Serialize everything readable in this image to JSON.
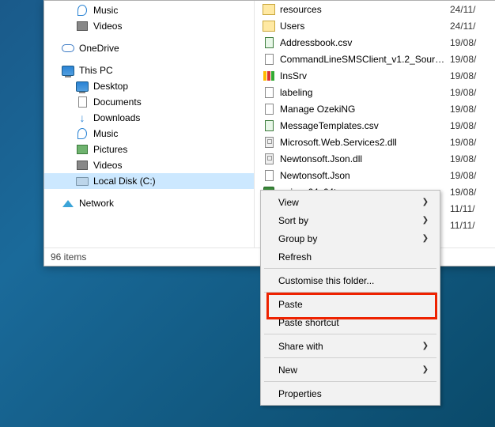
{
  "tree": {
    "music": "Music",
    "videos": "Videos",
    "onedrive": "OneDrive",
    "thispc": "This PC",
    "desktop": "Desktop",
    "documents": "Documents",
    "downloads": "Downloads",
    "music2": "Music",
    "pictures": "Pictures",
    "videos2": "Videos",
    "localdisk": "Local Disk (C:)",
    "network": "Network"
  },
  "files": [
    {
      "icon": "i-fol",
      "name": "resources",
      "date": "24/11/"
    },
    {
      "icon": "i-fol",
      "name": "Users",
      "date": "24/11/"
    },
    {
      "icon": "i-csv",
      "name": "Addressbook.csv",
      "date": "19/08/"
    },
    {
      "icon": "i-app",
      "name": "CommandLineSMSClient_v1.2_Source_D...",
      "date": "19/08/"
    },
    {
      "icon": "i-sig",
      "name": "InsSrv",
      "date": "19/08/"
    },
    {
      "icon": "i-doc",
      "name": "labeling",
      "date": "19/08/"
    },
    {
      "icon": "i-app",
      "name": "Manage OzekiNG",
      "date": "19/08/"
    },
    {
      "icon": "i-csv",
      "name": "MessageTemplates.csv",
      "date": "19/08/"
    },
    {
      "icon": "i-dll",
      "name": "Microsoft.Web.Services2.dll",
      "date": "19/08/"
    },
    {
      "icon": "i-dll",
      "name": "Newtonsoft.Json.dll",
      "date": "19/08/"
    },
    {
      "icon": "i-doc",
      "name": "Newtonsoft.Json",
      "date": "19/08/"
    },
    {
      "icon": "i-ng",
      "name": "ngicon64x64t",
      "date": "19/08/"
    },
    {
      "icon": "i-app",
      "name": "",
      "date": "11/11/"
    },
    {
      "icon": "i-app",
      "name": "",
      "date": "11/11/"
    }
  ],
  "status": {
    "items": "96 items"
  },
  "ctx": {
    "view": "View",
    "sortby": "Sort by",
    "groupby": "Group by",
    "refresh": "Refresh",
    "customise": "Customise this folder...",
    "paste": "Paste",
    "pasteshortcut": "Paste shortcut",
    "sharewith": "Share with",
    "new": "New",
    "properties": "Properties"
  }
}
